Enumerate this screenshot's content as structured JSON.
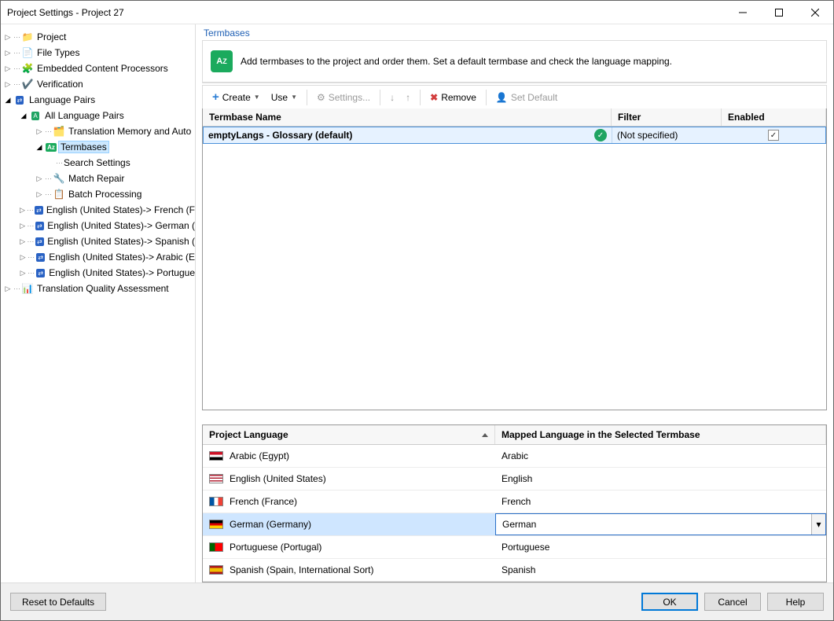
{
  "window": {
    "title": "Project Settings - Project 27"
  },
  "tree": {
    "project": "Project",
    "file_types": "File Types",
    "embedded": "Embedded Content Processors",
    "verification": "Verification",
    "language_pairs": "Language Pairs",
    "all_pairs": "All Language Pairs",
    "tm_auto": "Translation Memory and Auto",
    "termbases": "Termbases",
    "search_settings": "Search Settings",
    "match_repair": "Match Repair",
    "batch_processing": "Batch Processing",
    "en_fr": "English (United States)-> French (F",
    "en_de": "English (United States)-> German (",
    "en_es": "English (United States)-> Spanish (",
    "en_ar": "English (United States)-> Arabic (E",
    "en_pt": "English (United States)-> Portugue",
    "tqa": "Translation Quality Assessment"
  },
  "panel": {
    "title": "Termbases",
    "intro": "Add termbases to the project and order them. Set a default termbase and check the language mapping."
  },
  "toolbar": {
    "create": "Create",
    "use": "Use",
    "settings": "Settings...",
    "remove": "Remove",
    "set_default": "Set Default"
  },
  "grid": {
    "h_name": "Termbase Name",
    "h_filter": "Filter",
    "h_enabled": "Enabled",
    "row_name": "emptyLangs - Glossary (default)",
    "row_filter": "(Not specified)"
  },
  "lang": {
    "h_proj": "Project Language",
    "h_mapped": "Mapped Language in the Selected Termbase",
    "rows": [
      {
        "name": "Arabic (Egypt)",
        "mapped": "Arabic",
        "flag": "eg"
      },
      {
        "name": "English (United States)",
        "mapped": "English",
        "flag": "us"
      },
      {
        "name": "French (France)",
        "mapped": "French",
        "flag": "fr"
      },
      {
        "name": "German (Germany)",
        "mapped": "German",
        "flag": "de"
      },
      {
        "name": "Portuguese (Portugal)",
        "mapped": "Portuguese",
        "flag": "pt"
      },
      {
        "name": "Spanish (Spain, International Sort)",
        "mapped": "Spanish",
        "flag": "es"
      }
    ]
  },
  "buttons": {
    "reset": "Reset to Defaults",
    "ok": "OK",
    "cancel": "Cancel",
    "help": "Help"
  }
}
